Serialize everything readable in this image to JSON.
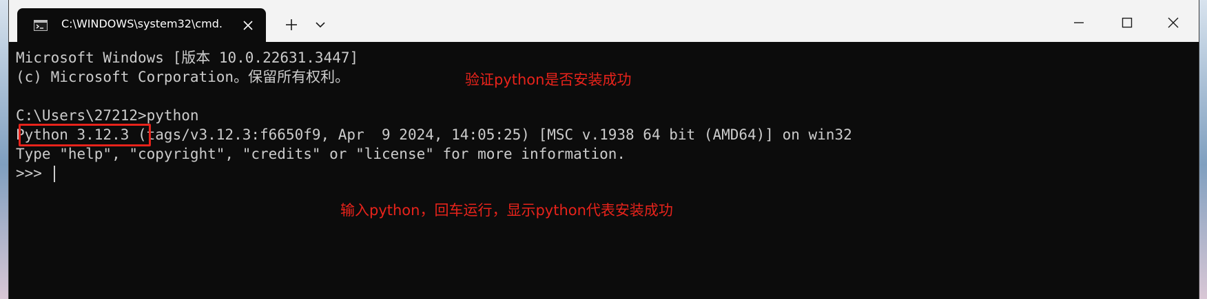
{
  "window": {
    "tab_title": "C:\\WINDOWS\\system32\\cmd.",
    "icons": {
      "tab": "console-icon",
      "close_tab": "close-icon",
      "new_tab": "plus-icon",
      "dropdown": "chevron-down-icon",
      "minimize": "minimize-icon",
      "maximize": "maximize-icon",
      "close_window": "close-icon"
    }
  },
  "console": {
    "lines": [
      "Microsoft Windows [版本 10.0.22631.3447]",
      "(c) Microsoft Corporation。保留所有权利。",
      "",
      "C:\\Users\\27212>python",
      "Python 3.12.3 (tags/v3.12.3:f6650f9, Apr  9 2024, 14:05:25) [MSC v.1938 64 bit (AMD64)] on win32",
      "Type \"help\", \"copyright\", \"credits\" or \"license\" for more information.",
      ">>> "
    ]
  },
  "annotations": {
    "verify": "验证python是否安装成功",
    "instruction": "输入python，回车运行，显示python代表安装成功"
  },
  "colors": {
    "terminal_bg": "#0c0c0c",
    "terminal_text": "#cccccc",
    "annotation_red": "#e8231b",
    "titlebar_bg": "#f3f3f3"
  }
}
